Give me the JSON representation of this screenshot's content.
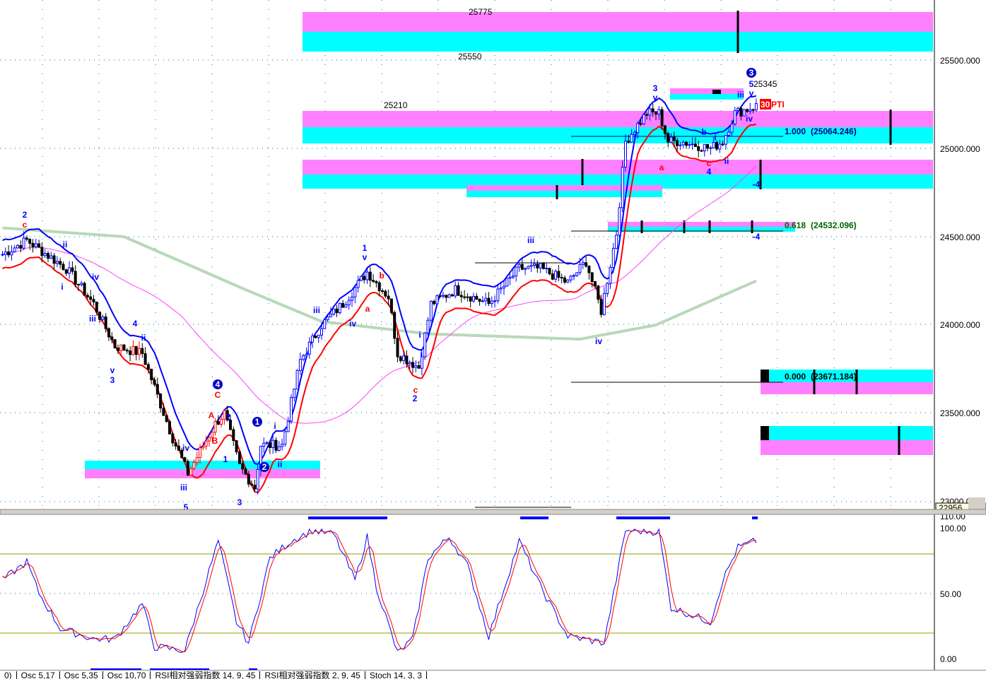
{
  "chart_data": {
    "type": "candlestick",
    "price_axis": {
      "ticks": [
        "25500.000",
        "25000.000",
        "24500.000",
        "24000.000",
        "23500.000",
        "23000.000"
      ],
      "range": [
        22956,
        25800
      ],
      "low_marker": "22956"
    },
    "osc_axis": {
      "ticks": [
        "110.00",
        "100.00",
        "50.00",
        "0.00"
      ],
      "range": [
        0,
        110
      ]
    },
    "price_anchors": [
      [
        0,
        24400
      ],
      [
        8,
        24480
      ],
      [
        21,
        24320
      ],
      [
        30,
        24120
      ],
      [
        37,
        23880
      ],
      [
        46,
        23840
      ],
      [
        56,
        23360
      ],
      [
        61,
        23160
      ],
      [
        70,
        23440
      ],
      [
        73,
        23500
      ],
      [
        78,
        23200
      ],
      [
        83,
        23080
      ],
      [
        85,
        23320
      ],
      [
        92,
        23320
      ],
      [
        98,
        23800
      ],
      [
        105,
        24000
      ],
      [
        112,
        24120
      ],
      [
        120,
        24300
      ],
      [
        127,
        24160
      ],
      [
        130,
        23840
      ],
      [
        137,
        23760
      ],
      [
        141,
        24120
      ],
      [
        149,
        24200
      ],
      [
        160,
        24120
      ],
      [
        170,
        24320
      ],
      [
        177,
        24320
      ],
      [
        186,
        24240
      ],
      [
        192,
        24360
      ],
      [
        197,
        24080
      ],
      [
        202,
        24520
      ],
      [
        205,
        25040
      ],
      [
        212,
        25200
      ],
      [
        216,
        25200
      ],
      [
        219,
        25040
      ],
      [
        223,
        25040
      ],
      [
        233,
        25000
      ],
      [
        237,
        25040
      ],
      [
        241,
        25200
      ],
      [
        248,
        25240
      ]
    ],
    "stoch_anchors": [
      [
        0,
        60
      ],
      [
        8,
        74
      ],
      [
        12,
        50
      ],
      [
        19,
        23
      ],
      [
        30,
        15
      ],
      [
        37,
        15
      ],
      [
        46,
        42
      ],
      [
        50,
        9
      ],
      [
        60,
        6
      ],
      [
        71,
        90
      ],
      [
        77,
        28
      ],
      [
        81,
        12
      ],
      [
        88,
        77
      ],
      [
        95,
        90
      ],
      [
        102,
        98
      ],
      [
        109,
        95
      ],
      [
        116,
        60
      ],
      [
        120,
        93
      ],
      [
        123,
        55
      ],
      [
        130,
        4
      ],
      [
        135,
        15
      ],
      [
        140,
        77
      ],
      [
        147,
        93
      ],
      [
        153,
        71
      ],
      [
        160,
        17
      ],
      [
        170,
        90
      ],
      [
        177,
        55
      ],
      [
        186,
        17
      ],
      [
        198,
        12
      ],
      [
        205,
        98
      ],
      [
        216,
        97
      ],
      [
        220,
        39
      ],
      [
        226,
        34
      ],
      [
        233,
        28
      ],
      [
        237,
        60
      ],
      [
        242,
        85
      ],
      [
        248,
        90
      ]
    ],
    "zone_labels": [
      "25775",
      "25550",
      "25210",
      "25345"
    ],
    "fib_levels": [
      {
        "ratio": "1.000",
        "price": "(25064.246)",
        "color": "#00008b"
      },
      {
        "ratio": "0.618",
        "price": "(24532.096)",
        "color": "#006400"
      },
      {
        "ratio": "0.000",
        "price": "(23671.184)",
        "color": "#000000"
      }
    ],
    "badge": {
      "num": "30",
      "text": "PTI"
    },
    "wave_labels": [
      "2",
      "c",
      "ii",
      "i",
      "iv",
      "iii",
      "4",
      "ii",
      "v",
      "3",
      "iv",
      "iii",
      "5",
      "C",
      "A",
      "B",
      "2",
      "1",
      "3",
      "4",
      "1",
      "i",
      "2",
      "ii",
      "iii",
      "iv",
      "1",
      "v",
      "b",
      "a",
      "i",
      "i",
      "c",
      "2",
      "iii",
      "iv",
      "3",
      "v",
      "a",
      "b",
      "c",
      "4",
      "i",
      "ii",
      "iii",
      "v",
      "iv",
      "5",
      "3",
      "-4",
      "-4"
    ],
    "colors": {
      "pink": "#ff80ff",
      "cyan": "#00ffff",
      "red_ma": "#ff0000",
      "blue_ma": "#0000ff",
      "long_ma": "#b8d8b8",
      "mid_ma": "#ff40ff"
    }
  },
  "tabs": [
    "0)",
    "Osc 5,17",
    "Osc 5,35",
    "Osc 10,70",
    "RSI相对强弱指数 14, 9, 45",
    "RSI相对强弱指数 2, 9, 45",
    "Stoch 14, 3, 3"
  ]
}
